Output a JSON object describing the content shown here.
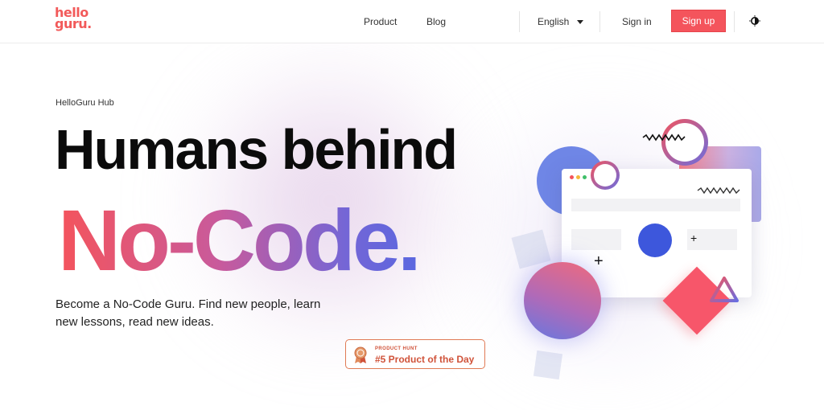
{
  "header": {
    "logo_line1": "hello",
    "logo_line2": "guru",
    "nav": {
      "product": "Product",
      "blog": "Blog"
    },
    "language": "English",
    "sign_in": "Sign in",
    "sign_up": "Sign up"
  },
  "hero": {
    "eyebrow": "HelloGuru Hub",
    "headline_line1": "Humans behind",
    "headline_line2": "No-Code.",
    "subcopy": "Become a No-Code Guru. Find new people, learn new lessons, read new ideas.",
    "badge": {
      "small_label": "PRODUCT HUNT",
      "title": "#5 Product of the Day"
    }
  },
  "colors": {
    "brand": "#f4545c",
    "accent_blue": "#3d57dc",
    "badge": "#d0533a"
  },
  "icons": {
    "theme_toggle": "contrast-icon",
    "language_caret": "chevron-down-icon",
    "badge_medal": "medal-icon"
  }
}
